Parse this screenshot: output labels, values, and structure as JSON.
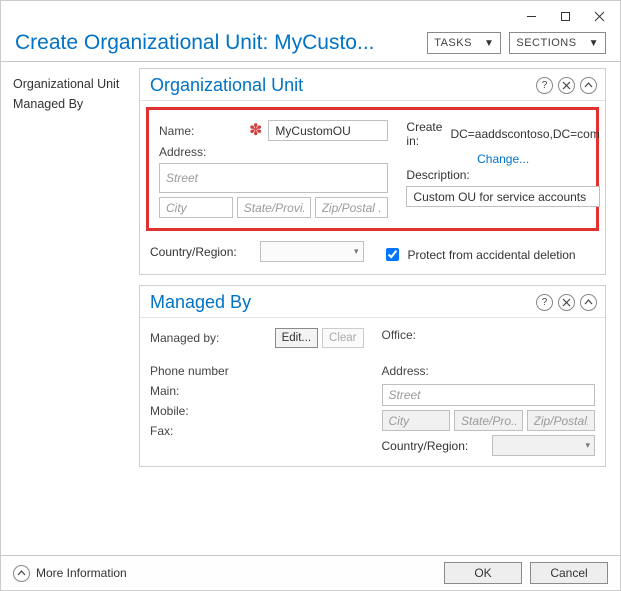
{
  "window": {
    "header_title": "Create Organizational Unit: MyCusto...",
    "tasks_label": "TASKS",
    "sections_label": "SECTIONS"
  },
  "sidebar": {
    "items": [
      {
        "label": "Organizational Unit"
      },
      {
        "label": "Managed By"
      }
    ]
  },
  "ou_section": {
    "title": "Organizational Unit",
    "name_label": "Name:",
    "name_value": "MyCustomOU",
    "address_label": "Address:",
    "street_placeholder": "Street",
    "city_placeholder": "City",
    "state_placeholder": "State/Provi...",
    "zip_placeholder": "Zip/Postal ...",
    "country_label": "Country/Region:",
    "create_in_label": "Create in:",
    "create_in_path": "DC=aaddscontoso,DC=com",
    "change_link": "Change...",
    "description_label": "Description:",
    "description_value": "Custom OU for service accounts",
    "protect_label": "Protect from accidental deletion"
  },
  "mb_section": {
    "title": "Managed By",
    "managed_by_label": "Managed by:",
    "edit_label": "Edit...",
    "clear_label": "Clear",
    "phone_label": "Phone number",
    "main_label": "Main:",
    "mobile_label": "Mobile:",
    "fax_label": "Fax:",
    "office_label": "Office:",
    "address_label": "Address:",
    "street_placeholder": "Street",
    "city_placeholder": "City",
    "state_placeholder": "State/Pro...",
    "zip_placeholder": "Zip/Postal...",
    "country_label": "Country/Region:"
  },
  "footer": {
    "more_info": "More Information",
    "ok": "OK",
    "cancel": "Cancel"
  }
}
